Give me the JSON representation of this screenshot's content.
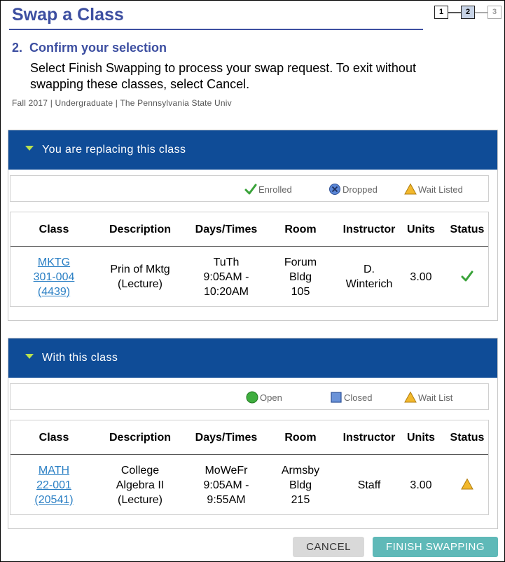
{
  "page": {
    "title": "Swap a Class",
    "steps": [
      "1",
      "2",
      "3"
    ],
    "step_heading": "2.  Confirm your selection",
    "instructions": "Select Finish Swapping to process your swap request. To exit without swapping these classes, select Cancel.",
    "term": "Fall 2017 | Undergraduate | The Pennsylvania State Univ"
  },
  "replacing": {
    "header": "You are replacing this class",
    "legend": {
      "enrolled": "Enrolled",
      "dropped": "Dropped",
      "wait_listed": "Wait Listed"
    },
    "columns": [
      "Class",
      "Description",
      "Days/Times",
      "Room",
      "Instructor",
      "Units",
      "Status"
    ],
    "row": {
      "class_lines": [
        "MKTG",
        "301-004",
        "(4439)"
      ],
      "description_lines": [
        "Prin of Mktg",
        "(Lecture)"
      ],
      "days_lines": [
        "TuTh",
        "9:05AM -",
        "10:20AM"
      ],
      "room_lines": [
        "Forum",
        "Bldg",
        "105"
      ],
      "instructor_lines": [
        "D.",
        "Winterich"
      ],
      "units": "3.00",
      "status_icon": "enrolled-check-icon"
    }
  },
  "with": {
    "header": "With this class",
    "legend": {
      "open": "Open",
      "closed": "Closed",
      "wait_list": "Wait List"
    },
    "columns": [
      "Class",
      "Description",
      "Days/Times",
      "Room",
      "Instructor",
      "Units",
      "Status"
    ],
    "row": {
      "class_lines": [
        "MATH",
        "22-001",
        "(20541)"
      ],
      "description_lines": [
        "College",
        "Algebra II",
        "(Lecture)"
      ],
      "days_lines": [
        "MoWeFr",
        "9:05AM -",
        "9:55AM"
      ],
      "room_lines": [
        "Armsby",
        "Bldg",
        "215"
      ],
      "instructor_lines": [
        "Staff"
      ],
      "units": "3.00",
      "status_icon": "wait-list-triangle-icon"
    }
  },
  "buttons": {
    "cancel": "CANCEL",
    "finish": "FINISH SWAPPING"
  },
  "colors": {
    "title": "#3d4fa1",
    "section_header": "#0f4c97",
    "link": "#2a7fc4",
    "finish_button": "#5fb9b8",
    "enrolled_green": "#3aa33a",
    "warning_yellow": "#f2b82c"
  }
}
